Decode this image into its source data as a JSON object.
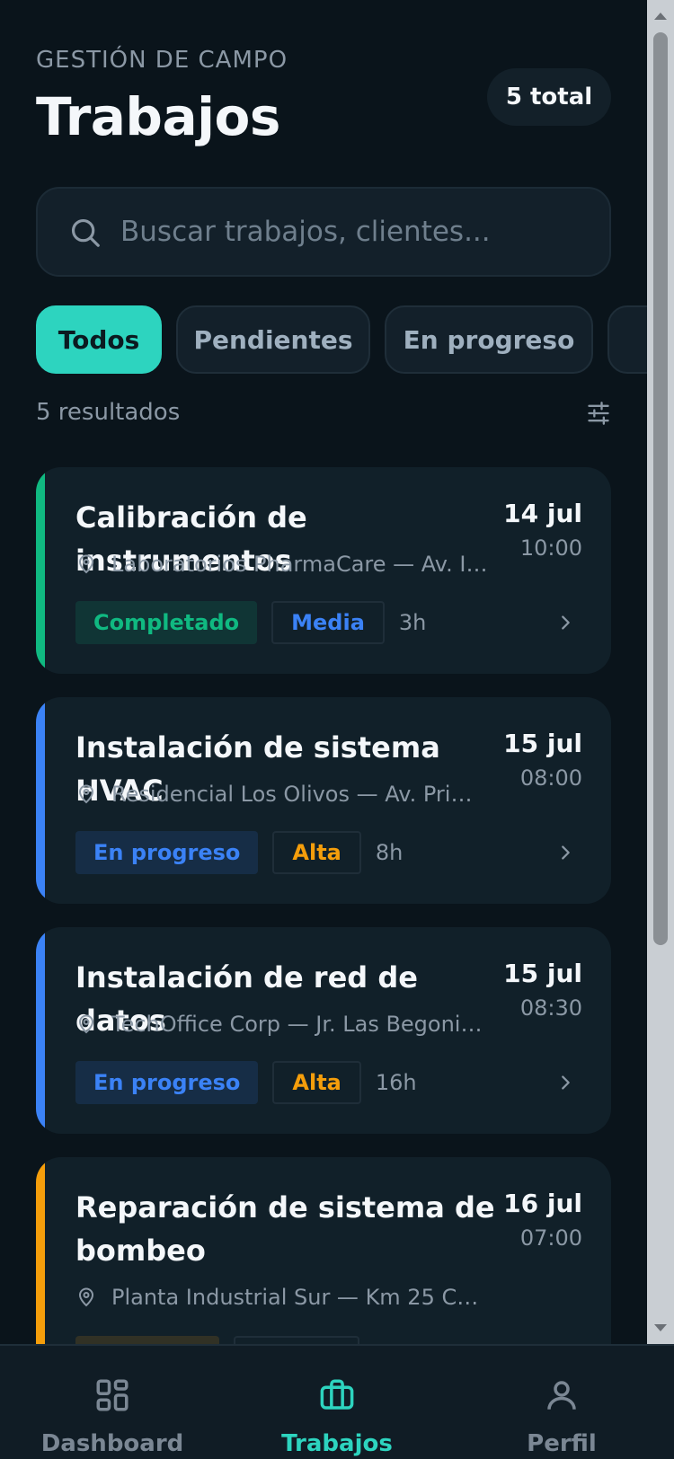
{
  "header": {
    "eyebrow": "GESTIÓN DE CAMPO",
    "title": "Trabajos",
    "total_badge": "5 total"
  },
  "search": {
    "placeholder": "Buscar trabajos, clientes...",
    "value": ""
  },
  "filters": {
    "chips": [
      {
        "label": "Todos",
        "active": true
      },
      {
        "label": "Pendientes",
        "active": false
      },
      {
        "label": "En progreso",
        "active": false
      },
      {
        "label": "",
        "active": false
      }
    ]
  },
  "results": {
    "count_text": "5 resultados",
    "filter_icon": "tune-icon"
  },
  "jobs": [
    {
      "title": "Calibración de instrumentos",
      "date": "14 jul",
      "time": "10:00",
      "location": "Laboratorios PharmaCare — Av. Ind...",
      "status": "Completado",
      "priority": "Media",
      "hours": "3h",
      "accent_color": "#10b981",
      "status_color": "#10b981",
      "priority_color": "#3b82f6"
    },
    {
      "title": "Instalación de sistema HVAC",
      "date": "15 jul",
      "time": "08:00",
      "location": "Residencial Los Olivos — Av. Primav...",
      "status": "En progreso",
      "priority": "Alta",
      "hours": "8h",
      "accent_color": "#3b82f6",
      "status_color": "#3b82f6",
      "priority_color": "#f59e0b"
    },
    {
      "title": "Instalación de red de datos",
      "date": "15 jul",
      "time": "08:30",
      "location": "TechOffice Corp — Jr. Las Begonias ...",
      "status": "En progreso",
      "priority": "Alta",
      "hours": "16h",
      "accent_color": "#3b82f6",
      "status_color": "#3b82f6",
      "priority_color": "#f59e0b"
    },
    {
      "title": "Reparación de sistema de bombeo",
      "date": "16 jul",
      "time": "07:00",
      "location": "Planta Industrial Sur — Km 25 Carre...",
      "status": "",
      "priority": "",
      "hours": "",
      "accent_color": "#f59e0b",
      "status_color": "#f59e0b",
      "priority_color": "#f59e0b"
    }
  ],
  "bottom_nav": [
    {
      "label": "Dashboard",
      "icon": "dashboard-icon",
      "active": false
    },
    {
      "label": "Trabajos",
      "icon": "briefcase-icon",
      "active": true
    },
    {
      "label": "Perfil",
      "icon": "user-icon",
      "active": false
    }
  ],
  "colors": {
    "accent": "#2dd4bf",
    "background": "#0a141b",
    "card": "#112029"
  }
}
